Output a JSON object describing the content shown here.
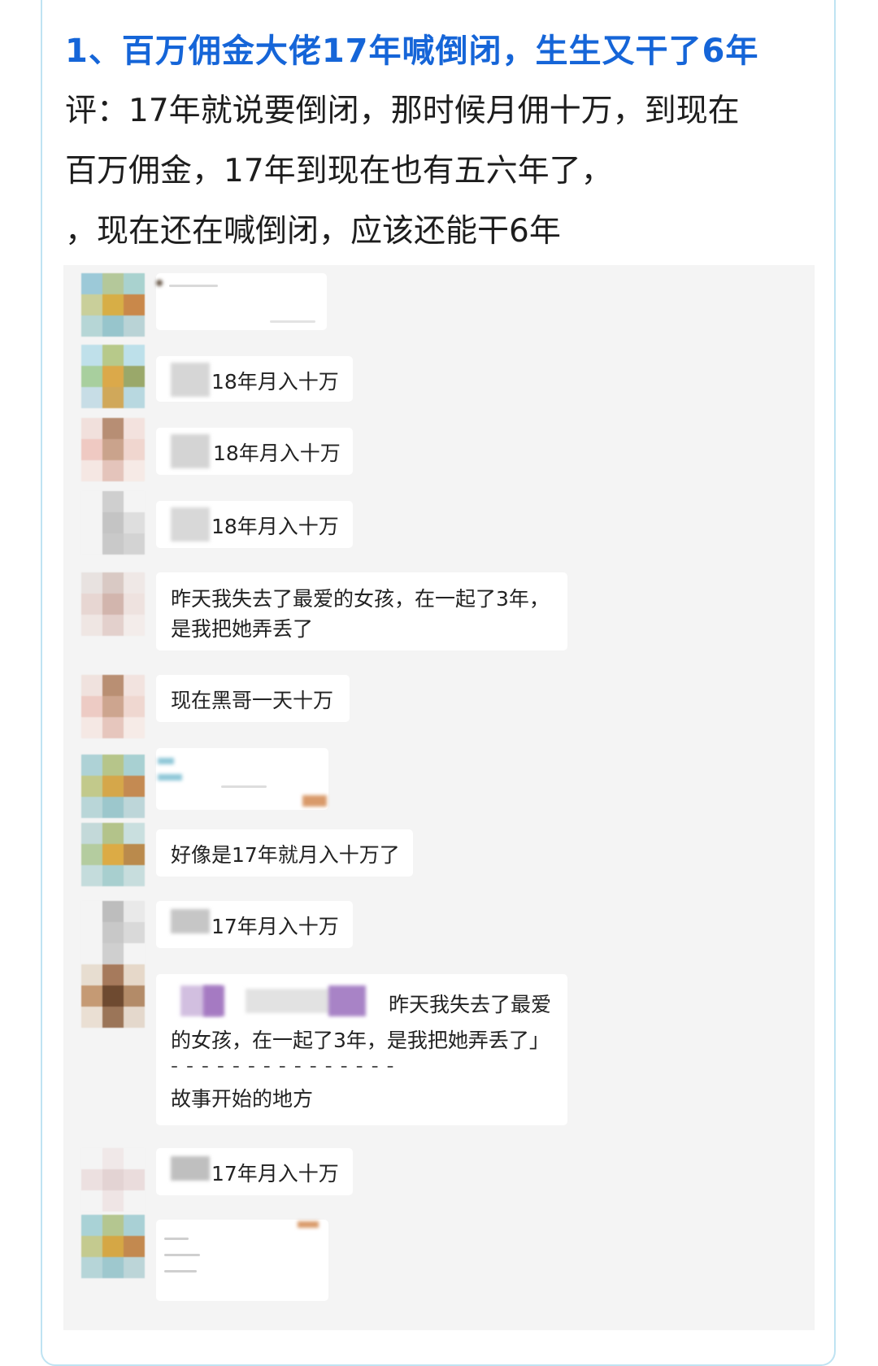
{
  "post": {
    "title": "1、百万佣金大佬17年喊倒闭，生生又干了6年",
    "comment_lines": [
      "评：17年就说要倒闭，那时候月佣十万，到现在",
      "百万佣金，17年到现在也有五六年了，",
      "，现在还在喊倒闭，应该还能干6年"
    ]
  },
  "chat": {
    "messages": [
      {
        "text": "18年月入十万"
      },
      {
        "text": "18年月入十万"
      },
      {
        "text": "18年月入十万"
      },
      {
        "lines": [
          "昨天我失去了最爱的女孩，在一起了3年，",
          "是我把她弄丢了"
        ]
      },
      {
        "text": "现在黑哥一天十万"
      },
      {
        "text": "好像是17年就月入十万了"
      },
      {
        "text": "17年月入十万"
      },
      {
        "lines": [
          "昨天我失去了最爱",
          "的女孩，在一起了3年，是我把她弄丢了」",
          "- - - - - - - - - - - - - - -",
          "故事开始的地方"
        ]
      },
      {
        "text": "17年月入十万"
      }
    ]
  },
  "colors": {
    "title": "#1565d8",
    "card_border": "#bfe3f2",
    "chat_bg": "#f4f4f4"
  }
}
